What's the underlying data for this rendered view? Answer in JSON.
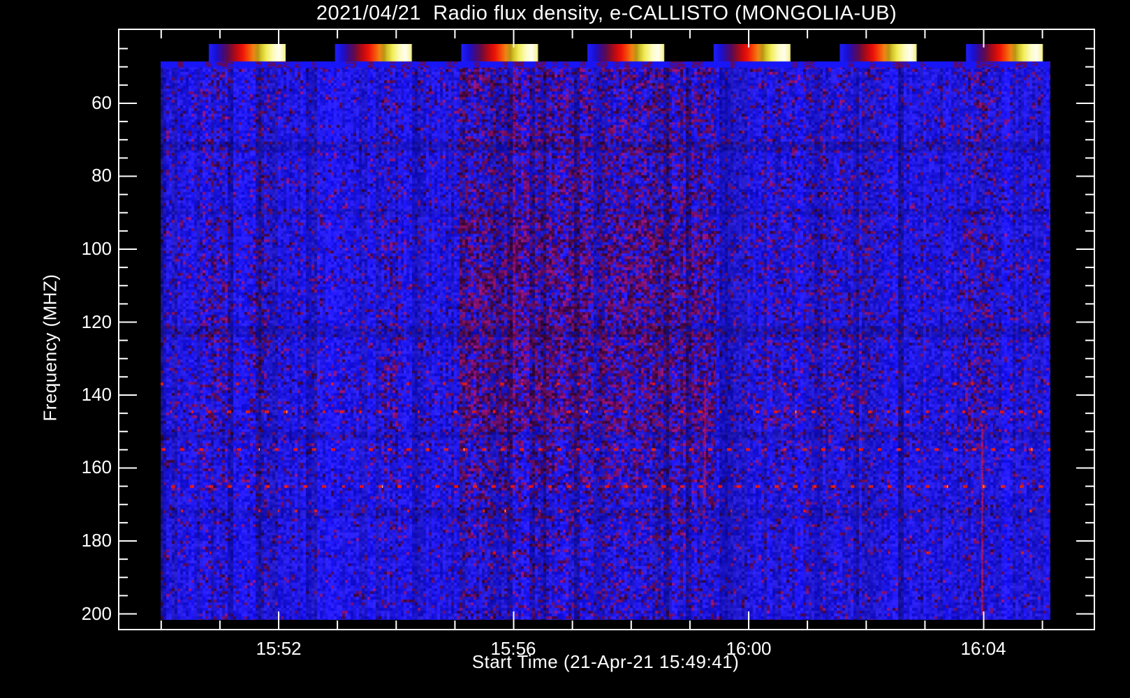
{
  "chart_data": {
    "type": "heatmap",
    "title": "2021/04/21  Radio flux density, e-CALLISTO (MONGOLIA-UB)",
    "xlabel": "Start Time (21-Apr-21 15:49:41)",
    "ylabel": "Frequency (MHZ)",
    "x_ticks": [
      "15:52",
      "15:56",
      "16:00",
      "16:04"
    ],
    "y_ticks": [
      "60",
      "80",
      "100",
      "120",
      "140",
      "160",
      "180",
      "200"
    ],
    "x_minor_tick_interval": "1 min",
    "y_minor_tick_interval": "5 MHz",
    "x_range": [
      "15:50:17",
      "16:05:25"
    ],
    "y_range_mhz": [
      40,
      200
    ],
    "grid": false,
    "date": "2021/04/21",
    "station": "MONGOLIA-UB",
    "instrument": "e-CALLISTO",
    "start_time": "15:49:41",
    "summary": "Quicklook dynamic radio spectrum: near-uniform low blue flux with faint red/purple enhancements around 15:55-15:59, horizontal dashed red RFI lines in the 135-185 MHz range, and seven repeated color-scale gradient segments along the top row of the image.",
    "colors": {
      "background": "#000000",
      "foreground": "#ffffff",
      "base_blue": "#1a16e6",
      "haze_purple": "#5c0a5c",
      "rfi_red": "#e61410"
    },
    "colorbar": {
      "segments": 7,
      "gradient": [
        [
          0.0,
          "#1f1fff"
        ],
        [
          0.1,
          "#1a10d0"
        ],
        [
          0.17,
          "#3c0a8c"
        ],
        [
          0.24,
          "#5c0a54"
        ],
        [
          0.3,
          "#8c0a28"
        ],
        [
          0.37,
          "#c40a10"
        ],
        [
          0.44,
          "#ee1408"
        ],
        [
          0.52,
          "#f55008"
        ],
        [
          0.58,
          "#f08414"
        ],
        [
          0.64,
          "#b89614"
        ],
        [
          0.68,
          "#d2c228"
        ],
        [
          0.75,
          "#f2ee5a"
        ],
        [
          0.84,
          "#fdfcc0"
        ],
        [
          0.92,
          "#fffef0"
        ],
        [
          1.0,
          "#f6f287"
        ]
      ]
    },
    "features": {
      "rfi_lines": [
        {
          "freq_mhz": 137.0,
          "strength": 0.3
        },
        {
          "freq_mhz": 144.6,
          "strength": 0.55
        },
        {
          "freq_mhz": 155.0,
          "strength": 0.95
        },
        {
          "freq_mhz": 165.0,
          "strength": 0.92
        },
        {
          "freq_mhz": 171.8,
          "strength": 0.18
        },
        {
          "freq_mhz": 183.3,
          "strength": 0.14
        }
      ],
      "enhanced_bands": [
        {
          "start": "15:55:05",
          "end": "15:57:20",
          "strength": 1.0
        },
        {
          "start": "15:57:25",
          "end": "15:59:25",
          "strength": 0.9
        },
        {
          "start": "15:50:40",
          "end": "15:51:10",
          "strength": 0.5
        },
        {
          "start": "15:51:30",
          "end": "15:51:50",
          "strength": 0.45
        },
        {
          "start": "15:53:45",
          "end": "15:54:05",
          "strength": 0.4
        },
        {
          "start": "16:00:10",
          "end": "16:02:10",
          "strength": 0.32
        },
        {
          "start": "16:03:40",
          "end": "16:04:10",
          "strength": 0.45
        }
      ],
      "haze_rows": [
        {
          "f0": 48,
          "f1": 92,
          "weight": 0.7
        },
        {
          "f0": 92,
          "f1": 150,
          "weight": 1.0
        },
        {
          "f0": 150,
          "f1": 166,
          "weight": 0.6
        },
        {
          "f0": 166,
          "f1": 180,
          "weight": 0.4
        },
        {
          "f0": 180,
          "f1": 200,
          "weight": 0.25
        }
      ],
      "dark_rows": [
        {
          "f0": 70.5,
          "f1": 73,
          "scale": 0.86
        },
        {
          "f0": 89,
          "f1": 90.5,
          "scale": 0.9
        },
        {
          "f0": 121,
          "f1": 124,
          "scale": 0.86
        },
        {
          "f0": 150,
          "f1": 152,
          "scale": 0.9
        },
        {
          "f0": 171,
          "f1": 173.5,
          "scale": 0.9
        }
      ],
      "red_streaks": [
        {
          "time": "15:59:15",
          "f0": 135,
          "f1": 168,
          "weak": false
        },
        {
          "time": "16:03:58",
          "f0": 148,
          "f1": 200,
          "weak": false
        },
        {
          "time": "15:56:00",
          "f0": 50,
          "f1": 140,
          "weak": true
        }
      ]
    }
  }
}
